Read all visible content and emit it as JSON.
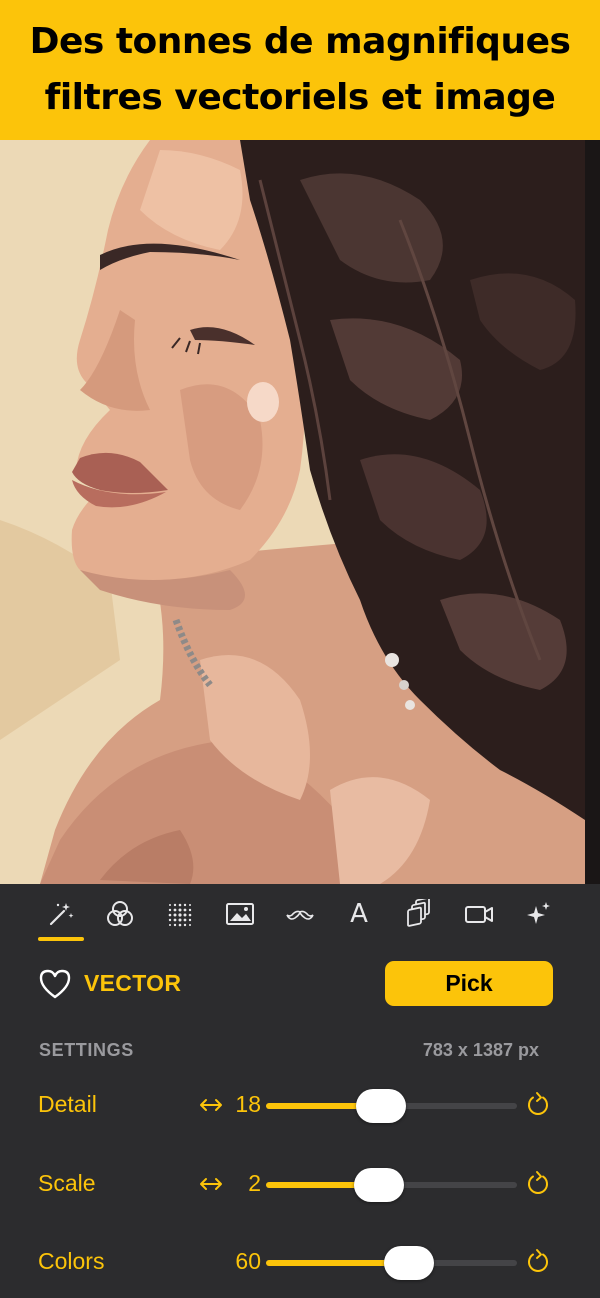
{
  "banner": {
    "title": "Des tonnes de magnifiques\nfiltres vectoriels et image",
    "background": "#fcc40a"
  },
  "photo": {
    "subject": "vector-filtered portrait",
    "colors": {
      "background": "#ecd9b6",
      "hair": "#2c1e1c",
      "skin": "#d8a487"
    }
  },
  "toolbar": {
    "tools": [
      {
        "icon": "magic-wand-icon",
        "active": true
      },
      {
        "icon": "color-circles-icon"
      },
      {
        "icon": "halftone-dots-icon"
      },
      {
        "icon": "image-icon"
      },
      {
        "icon": "mustache-icon"
      },
      {
        "icon": "text-icon",
        "letter": "A"
      },
      {
        "icon": "layers-icon"
      },
      {
        "icon": "video-camera-icon"
      },
      {
        "icon": "sparkles-icon"
      }
    ],
    "accent": "#fcc40a"
  },
  "filter": {
    "name": "VECTOR",
    "favorite_icon": "heart-icon",
    "pick_label": "Pick"
  },
  "settings": {
    "label": "SETTINGS",
    "dimensions": "783 x 1387 px",
    "sliders": [
      {
        "label": "Detail",
        "value": "18",
        "arrows": true,
        "fraction": 0.46
      },
      {
        "label": "Scale",
        "value": "2",
        "arrows": true,
        "fraction": 0.45
      },
      {
        "label": "Colors",
        "value": "60",
        "arrows": false,
        "fraction": 0.57
      }
    ]
  }
}
